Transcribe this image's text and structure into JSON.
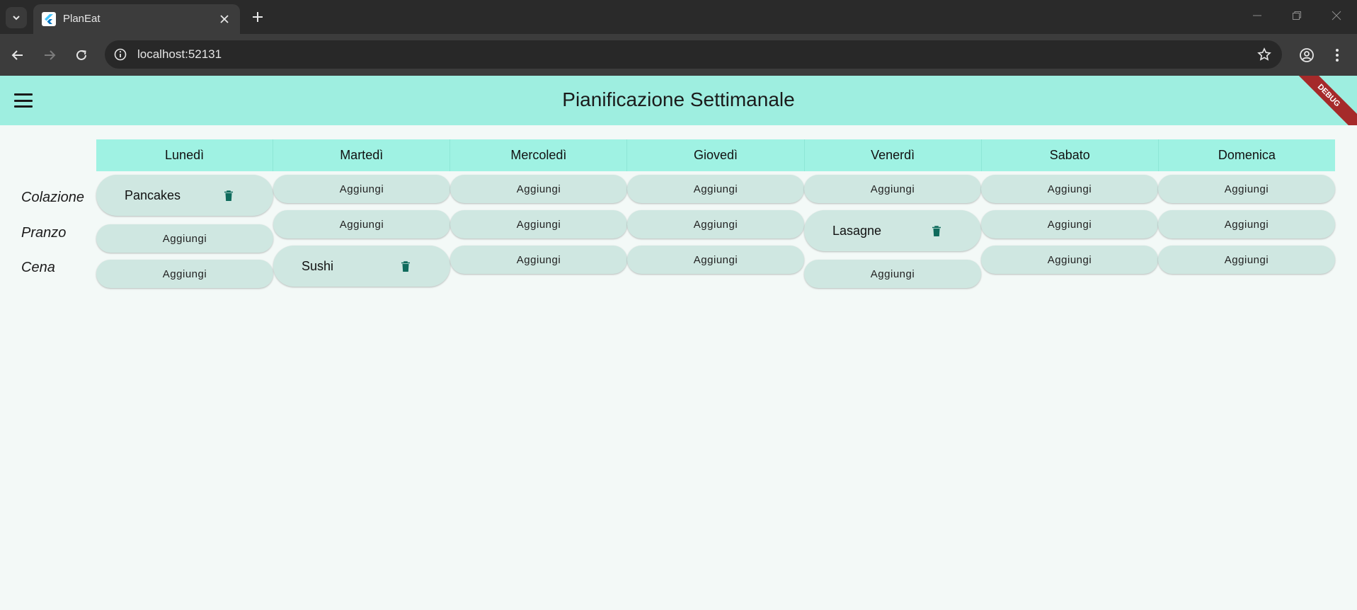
{
  "browser": {
    "tab_title": "PlanEat",
    "url": "localhost:52131"
  },
  "app": {
    "title": "Pianificazione Settimanale",
    "debug_label": "DEBUG"
  },
  "days": [
    "Lunedì",
    "Martedì",
    "Mercoledì",
    "Giovedì",
    "Venerdì",
    "Sabato",
    "Domenica"
  ],
  "meals": [
    "Colazione",
    "Pranzo",
    "Cena"
  ],
  "add_label": "Aggiungi",
  "planned": {
    "monday_breakfast": "Pancakes",
    "tuesday_dinner": "Sushi",
    "friday_lunch": "Lasagne"
  },
  "colors": {
    "appbar": "#9eeee0",
    "header": "#9ff2e3",
    "cell": "#cfe7e1",
    "trash": "#0f6b5c",
    "debug": "#a52a2a"
  }
}
